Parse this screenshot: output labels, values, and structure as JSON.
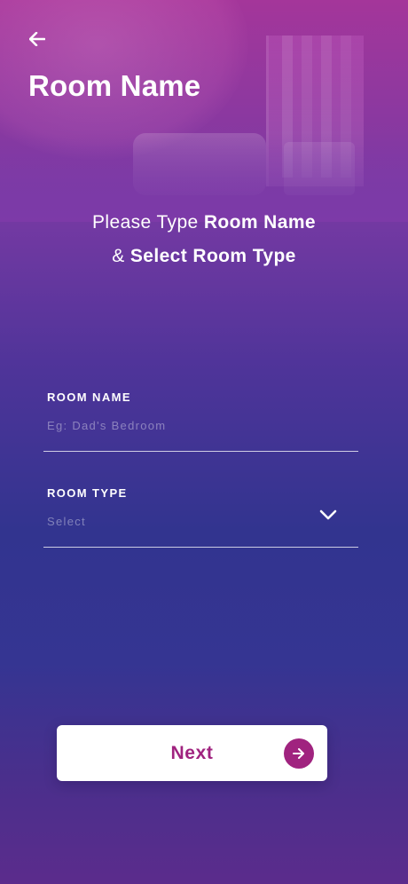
{
  "header": {
    "back_icon": "arrow-left-icon",
    "title": "Room Name"
  },
  "intro": {
    "line1_normal": "Please Type ",
    "line1_bold": "Room Name",
    "line2_normal": "& ",
    "line2_bold": "Select Room Type"
  },
  "form": {
    "room_name": {
      "label": "ROOM NAME",
      "value": "",
      "placeholder": "Eg: Dad's Bedroom"
    },
    "room_type": {
      "label": "ROOM TYPE",
      "selected": "Select",
      "icon": "chevron-down-icon"
    }
  },
  "actions": {
    "next_label": "Next",
    "next_icon": "arrow-right-circle-icon"
  },
  "colors": {
    "accent": "#a0237f",
    "gradient_top": "#a4369a",
    "gradient_mid": "#32348f",
    "button_bg": "#ffffff"
  }
}
